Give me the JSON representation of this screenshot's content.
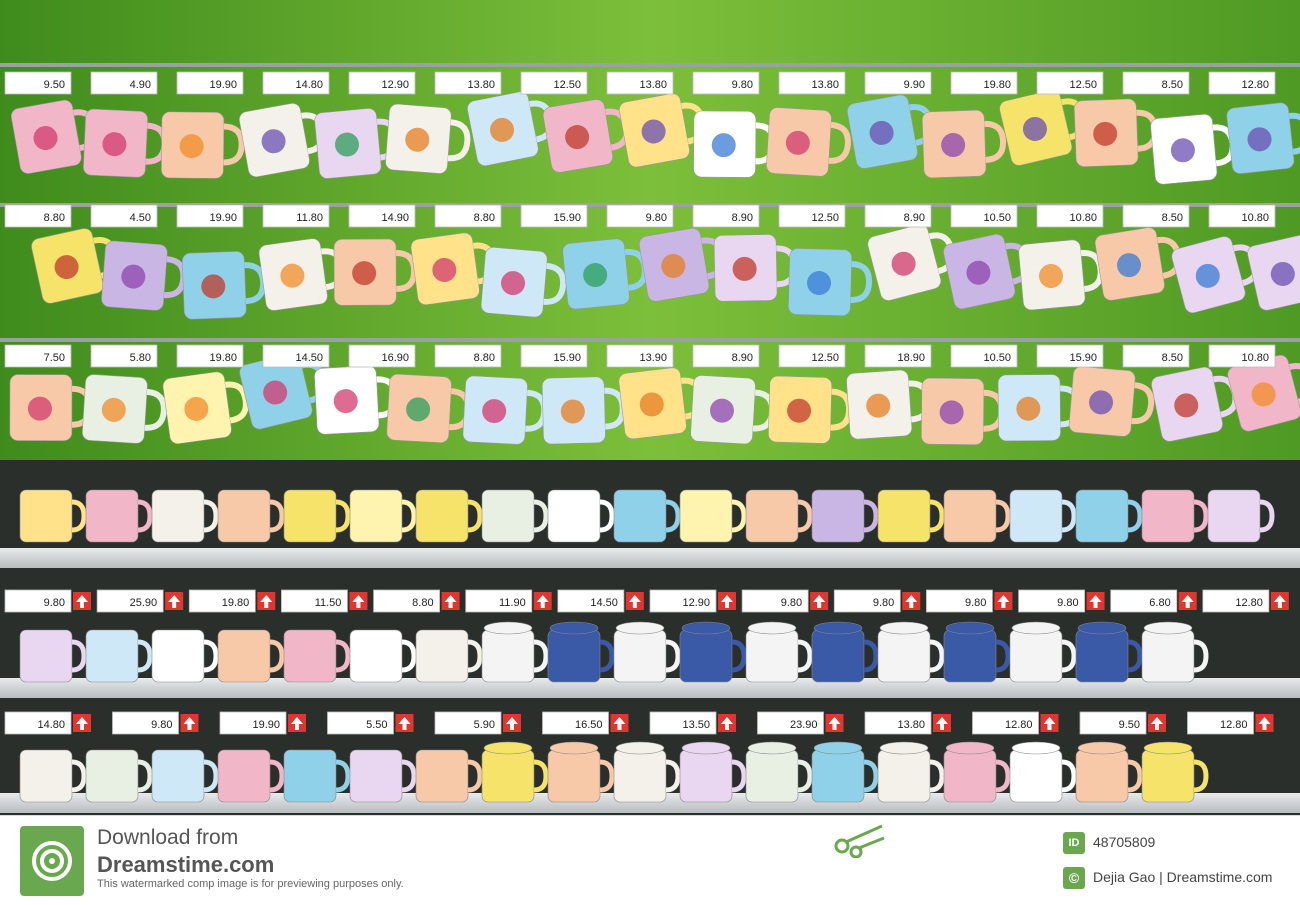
{
  "photo": {
    "alt": "",
    "price_rows": [
      {
        "tags": [
          "9.50",
          "4.90",
          "19.90",
          "14.80",
          "12.90",
          "13.80",
          "12.50",
          "13.80",
          "9.80",
          "13.80",
          "9.90",
          "19.80",
          "12.50",
          "8.50",
          "12.80"
        ]
      },
      {
        "tags": [
          "8.80",
          "4.50",
          "19.90",
          "11.80",
          "14.90",
          "8.80",
          "15.90",
          "9.80",
          "8.90",
          "12.50",
          "8.90",
          "10.50",
          "10.80",
          "8.50",
          "10.80"
        ]
      },
      {
        "tags": [
          "7.50",
          "5.80",
          "19.80",
          "14.50",
          "16.90",
          "8.80",
          "15.90",
          "13.90",
          "8.90",
          "12.50",
          "18.90",
          "10.50",
          "15.90",
          "8.50",
          "10.80"
        ]
      },
      {
        "tags": [
          "9.80",
          "25.90",
          "19.80",
          "11.50",
          "8.80",
          "11.90",
          "14.50",
          "12.90",
          "9.80",
          "9.80",
          "9.80",
          "9.80",
          "6.80",
          "12.80"
        ]
      },
      {
        "tags": [
          "14.80",
          "9.80",
          "19.90",
          "5.50",
          "5.90",
          "16.50",
          "13.50",
          "23.90",
          "13.80",
          "12.80",
          "9.50",
          "12.80"
        ]
      }
    ]
  },
  "footer": {
    "download_line": "Download from",
    "site_name": "Dreamstime.com",
    "notice": "This watermarked comp image is for previewing purposes only.",
    "image_id": "48705809",
    "credit": "Dejia Gao | Dreamstime.com",
    "colors": {
      "brand": "#6aa84f",
      "shelf": "#cfd2d4",
      "wall": "#4f9a24",
      "price_arrow": "#e0362d"
    }
  }
}
